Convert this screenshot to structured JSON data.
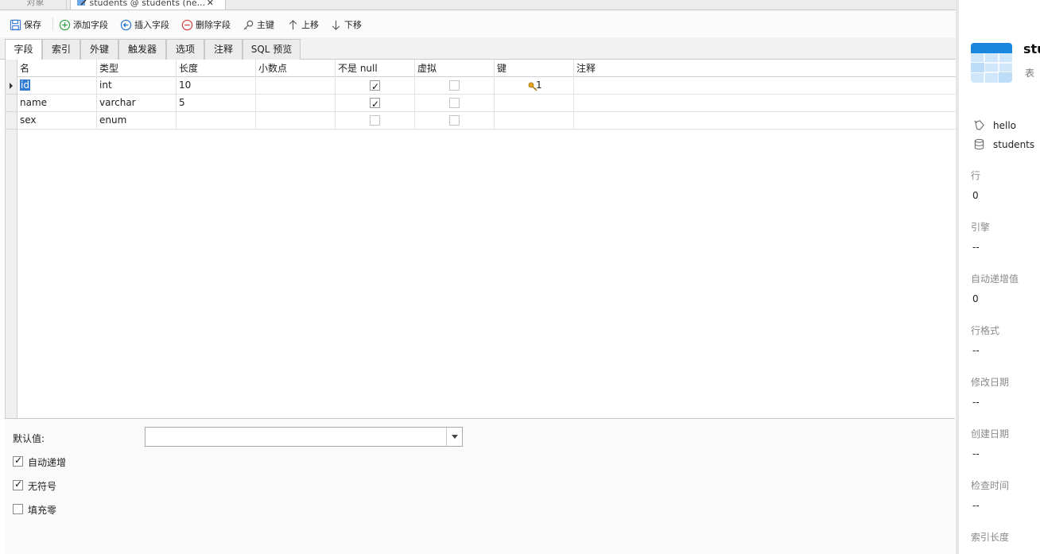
{
  "doc_tabs": [
    {
      "label": "对象"
    },
    {
      "label": "students @ students (ne..."
    }
  ],
  "toolbar": {
    "save": "保存",
    "add_field": "添加字段",
    "insert_field": "插入字段",
    "delete_field": "删除字段",
    "primary_key": "主键",
    "move_up": "上移",
    "move_down": "下移"
  },
  "subtabs": [
    "字段",
    "索引",
    "外键",
    "触发器",
    "选项",
    "注释",
    "SQL 预览"
  ],
  "grid": {
    "columns": [
      "名",
      "类型",
      "长度",
      "小数点",
      "不是 null",
      "虚拟",
      "键",
      "注释"
    ],
    "rows": [
      {
        "name": "id",
        "type": "int",
        "length": "10",
        "decimal": "",
        "not_null": true,
        "virtual": false,
        "key": "1",
        "comment": ""
      },
      {
        "name": "name",
        "type": "varchar",
        "length": "5",
        "decimal": "",
        "not_null": true,
        "virtual": false,
        "key": "",
        "comment": ""
      },
      {
        "name": "sex",
        "type": "enum",
        "length": "",
        "decimal": "",
        "not_null": false,
        "virtual": false,
        "key": "",
        "comment": ""
      }
    ]
  },
  "props": {
    "default_label": "默认值:",
    "default_value": "",
    "auto_increment_label": "自动递增",
    "auto_increment": true,
    "unsigned_label": "无符号",
    "unsigned": true,
    "zerofill_label": "填充零",
    "zerofill": false
  },
  "info": {
    "title": "stu",
    "subtitle": "表",
    "refs": [
      "hello",
      "students"
    ],
    "fields": [
      {
        "key": "行",
        "value": "0"
      },
      {
        "key": "引擎",
        "value": "--"
      },
      {
        "key": "自动递增值",
        "value": "0"
      },
      {
        "key": "行格式",
        "value": "--"
      },
      {
        "key": "修改日期",
        "value": "--"
      },
      {
        "key": "创建日期",
        "value": "--"
      },
      {
        "key": "检查时间",
        "value": "--"
      },
      {
        "key": "索引长度",
        "value": ""
      }
    ]
  },
  "colors": {
    "selection": "#2f7bd6",
    "table_icon": "#1a86de",
    "add_icon": "#2ea043",
    "insert_icon": "#1e6fd0",
    "delete_icon": "#d73a3a"
  }
}
